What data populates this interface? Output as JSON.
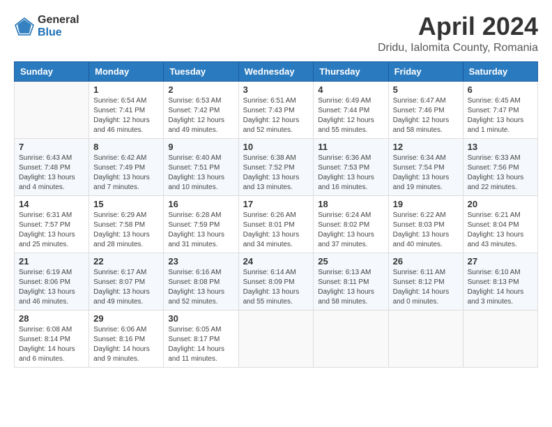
{
  "header": {
    "logo_general": "General",
    "logo_blue": "Blue",
    "month_title": "April 2024",
    "location": "Dridu, Ialomita County, Romania"
  },
  "days_of_week": [
    "Sunday",
    "Monday",
    "Tuesday",
    "Wednesday",
    "Thursday",
    "Friday",
    "Saturday"
  ],
  "weeks": [
    [
      {
        "day": "",
        "info": ""
      },
      {
        "day": "1",
        "info": "Sunrise: 6:54 AM\nSunset: 7:41 PM\nDaylight: 12 hours\nand 46 minutes."
      },
      {
        "day": "2",
        "info": "Sunrise: 6:53 AM\nSunset: 7:42 PM\nDaylight: 12 hours\nand 49 minutes."
      },
      {
        "day": "3",
        "info": "Sunrise: 6:51 AM\nSunset: 7:43 PM\nDaylight: 12 hours\nand 52 minutes."
      },
      {
        "day": "4",
        "info": "Sunrise: 6:49 AM\nSunset: 7:44 PM\nDaylight: 12 hours\nand 55 minutes."
      },
      {
        "day": "5",
        "info": "Sunrise: 6:47 AM\nSunset: 7:46 PM\nDaylight: 12 hours\nand 58 minutes."
      },
      {
        "day": "6",
        "info": "Sunrise: 6:45 AM\nSunset: 7:47 PM\nDaylight: 13 hours\nand 1 minute."
      }
    ],
    [
      {
        "day": "7",
        "info": "Sunrise: 6:43 AM\nSunset: 7:48 PM\nDaylight: 13 hours\nand 4 minutes."
      },
      {
        "day": "8",
        "info": "Sunrise: 6:42 AM\nSunset: 7:49 PM\nDaylight: 13 hours\nand 7 minutes."
      },
      {
        "day": "9",
        "info": "Sunrise: 6:40 AM\nSunset: 7:51 PM\nDaylight: 13 hours\nand 10 minutes."
      },
      {
        "day": "10",
        "info": "Sunrise: 6:38 AM\nSunset: 7:52 PM\nDaylight: 13 hours\nand 13 minutes."
      },
      {
        "day": "11",
        "info": "Sunrise: 6:36 AM\nSunset: 7:53 PM\nDaylight: 13 hours\nand 16 minutes."
      },
      {
        "day": "12",
        "info": "Sunrise: 6:34 AM\nSunset: 7:54 PM\nDaylight: 13 hours\nand 19 minutes."
      },
      {
        "day": "13",
        "info": "Sunrise: 6:33 AM\nSunset: 7:56 PM\nDaylight: 13 hours\nand 22 minutes."
      }
    ],
    [
      {
        "day": "14",
        "info": "Sunrise: 6:31 AM\nSunset: 7:57 PM\nDaylight: 13 hours\nand 25 minutes."
      },
      {
        "day": "15",
        "info": "Sunrise: 6:29 AM\nSunset: 7:58 PM\nDaylight: 13 hours\nand 28 minutes."
      },
      {
        "day": "16",
        "info": "Sunrise: 6:28 AM\nSunset: 7:59 PM\nDaylight: 13 hours\nand 31 minutes."
      },
      {
        "day": "17",
        "info": "Sunrise: 6:26 AM\nSunset: 8:01 PM\nDaylight: 13 hours\nand 34 minutes."
      },
      {
        "day": "18",
        "info": "Sunrise: 6:24 AM\nSunset: 8:02 PM\nDaylight: 13 hours\nand 37 minutes."
      },
      {
        "day": "19",
        "info": "Sunrise: 6:22 AM\nSunset: 8:03 PM\nDaylight: 13 hours\nand 40 minutes."
      },
      {
        "day": "20",
        "info": "Sunrise: 6:21 AM\nSunset: 8:04 PM\nDaylight: 13 hours\nand 43 minutes."
      }
    ],
    [
      {
        "day": "21",
        "info": "Sunrise: 6:19 AM\nSunset: 8:06 PM\nDaylight: 13 hours\nand 46 minutes."
      },
      {
        "day": "22",
        "info": "Sunrise: 6:17 AM\nSunset: 8:07 PM\nDaylight: 13 hours\nand 49 minutes."
      },
      {
        "day": "23",
        "info": "Sunrise: 6:16 AM\nSunset: 8:08 PM\nDaylight: 13 hours\nand 52 minutes."
      },
      {
        "day": "24",
        "info": "Sunrise: 6:14 AM\nSunset: 8:09 PM\nDaylight: 13 hours\nand 55 minutes."
      },
      {
        "day": "25",
        "info": "Sunrise: 6:13 AM\nSunset: 8:11 PM\nDaylight: 13 hours\nand 58 minutes."
      },
      {
        "day": "26",
        "info": "Sunrise: 6:11 AM\nSunset: 8:12 PM\nDaylight: 14 hours\nand 0 minutes."
      },
      {
        "day": "27",
        "info": "Sunrise: 6:10 AM\nSunset: 8:13 PM\nDaylight: 14 hours\nand 3 minutes."
      }
    ],
    [
      {
        "day": "28",
        "info": "Sunrise: 6:08 AM\nSunset: 8:14 PM\nDaylight: 14 hours\nand 6 minutes."
      },
      {
        "day": "29",
        "info": "Sunrise: 6:06 AM\nSunset: 8:16 PM\nDaylight: 14 hours\nand 9 minutes."
      },
      {
        "day": "30",
        "info": "Sunrise: 6:05 AM\nSunset: 8:17 PM\nDaylight: 14 hours\nand 11 minutes."
      },
      {
        "day": "",
        "info": ""
      },
      {
        "day": "",
        "info": ""
      },
      {
        "day": "",
        "info": ""
      },
      {
        "day": "",
        "info": ""
      }
    ]
  ]
}
